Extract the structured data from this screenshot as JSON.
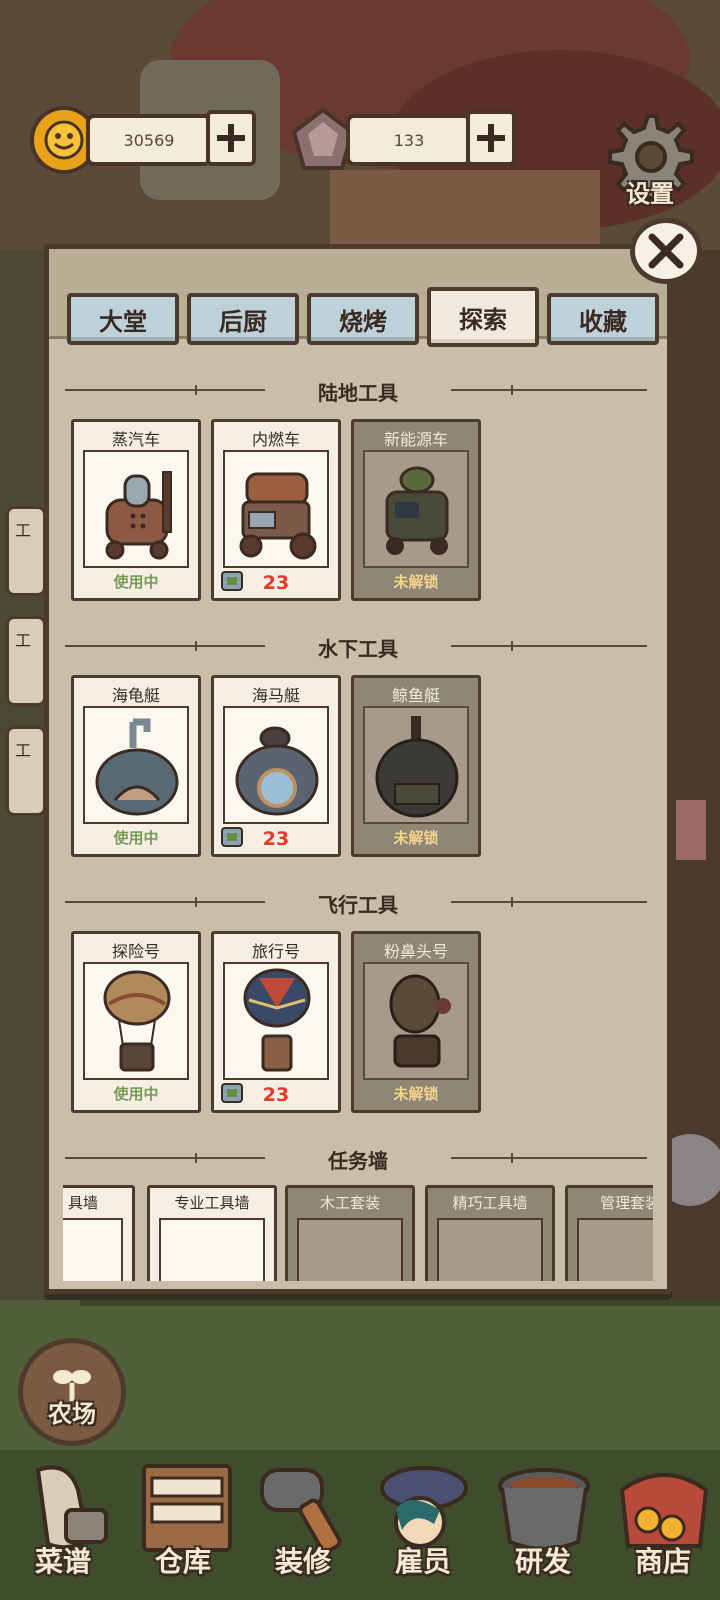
{
  "resources": {
    "coins": "30569",
    "gems": "133",
    "settings_label": "设置"
  },
  "tabs": [
    {
      "label": "大堂",
      "active": false
    },
    {
      "label": "后厨",
      "active": false
    },
    {
      "label": "烧烤",
      "active": false
    },
    {
      "label": "探索",
      "active": true
    },
    {
      "label": "收藏",
      "active": false
    }
  ],
  "sections": {
    "land": {
      "title": "陆地工具",
      "items": [
        {
          "name": "蒸汽车",
          "status": "使用中",
          "state": "in-use"
        },
        {
          "name": "内燃车",
          "cost": "23",
          "state": "buy"
        },
        {
          "name": "新能源车",
          "status": "未解锁",
          "state": "locked"
        }
      ]
    },
    "water": {
      "title": "水下工具",
      "items": [
        {
          "name": "海龟艇",
          "status": "使用中",
          "state": "in-use"
        },
        {
          "name": "海马艇",
          "cost": "23",
          "state": "buy"
        },
        {
          "name": "鲸鱼艇",
          "status": "未解锁",
          "state": "locked"
        }
      ]
    },
    "air": {
      "title": "飞行工具",
      "items": [
        {
          "name": "探险号",
          "status": "使用中",
          "state": "in-use"
        },
        {
          "name": "旅行号",
          "cost": "23",
          "state": "buy"
        },
        {
          "name": "粉鼻头号",
          "status": "未解锁",
          "state": "locked"
        }
      ]
    },
    "tasks": {
      "title": "任务墙",
      "items": [
        {
          "name": "具墙"
        },
        {
          "name": "专业工具墙"
        },
        {
          "name": "木工套装"
        },
        {
          "name": "精巧工具墙"
        },
        {
          "name": "管理套装"
        }
      ]
    }
  },
  "side_tags": [
    "工",
    "工",
    "工"
  ],
  "farm_label": "农场",
  "bottom_nav": [
    {
      "label": "菜谱"
    },
    {
      "label": "仓库"
    },
    {
      "label": "装修"
    },
    {
      "label": "雇员"
    },
    {
      "label": "研发"
    },
    {
      "label": "商店"
    }
  ],
  "colors": {
    "panel": "#c9bfa8",
    "tab": "#bfd1d8",
    "cost_red": "#e23b2b",
    "in_use_green": "#7a9a56",
    "locked_gold": "#f3d489"
  }
}
